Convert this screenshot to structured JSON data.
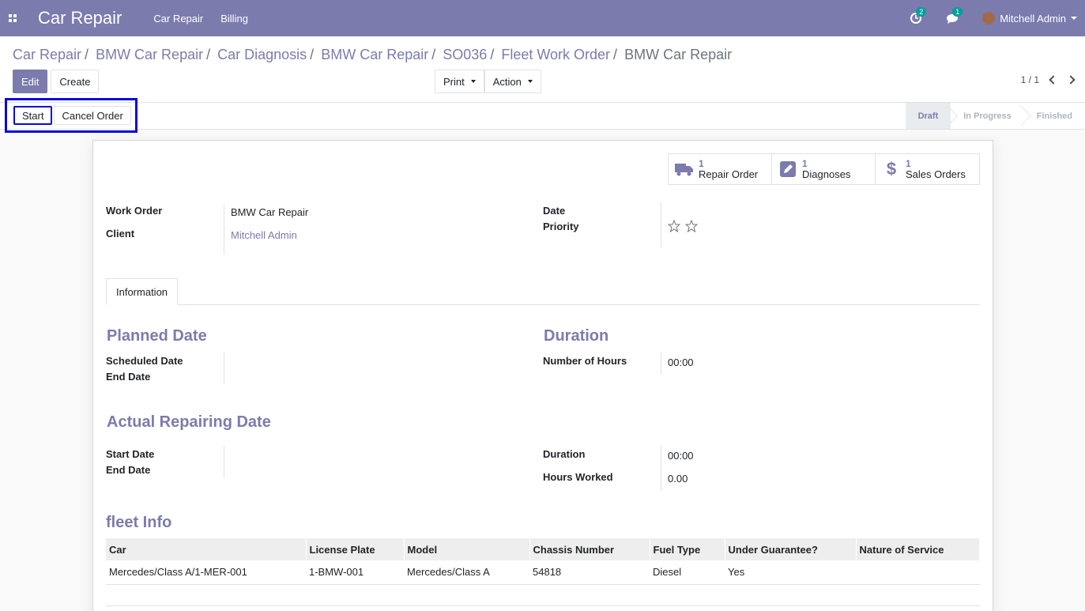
{
  "navbar": {
    "brand": "Car Repair",
    "menu": [
      "Car Repair",
      "Billing"
    ],
    "activity_count": "2",
    "message_count": "1",
    "user": "Mitchell Admin"
  },
  "breadcrumb": [
    "Car Repair",
    "BMW Car Repair",
    "Car Diagnosis",
    "BMW Car Repair",
    "SO036",
    "Fleet Work Order",
    "BMW Car Repair"
  ],
  "buttons": {
    "edit": "Edit",
    "create": "Create",
    "print": "Print",
    "action": "Action",
    "start": "Start",
    "cancel_order": "Cancel Order"
  },
  "pager": "1 / 1",
  "stages": [
    "Draft",
    "In Progress",
    "Finished"
  ],
  "current_stage": "Draft",
  "smart_buttons": [
    {
      "count": "1",
      "label": "Repair Order",
      "icon": "truck-icon"
    },
    {
      "count": "1",
      "label": "Diagnoses",
      "icon": "pencil-square-icon"
    },
    {
      "count": "1",
      "label": "Sales Orders",
      "icon": "dollar-icon"
    }
  ],
  "form": {
    "work_order_label": "Work Order",
    "work_order": "BMW Car Repair",
    "client_label": "Client",
    "client": "Mitchell Admin",
    "date_label": "Date",
    "priority_label": "Priority",
    "tab_information": "Information",
    "planned_date_title": "Planned Date",
    "scheduled_date_label": "Scheduled Date",
    "end_date_label": "End Date",
    "duration_title": "Duration",
    "number_of_hours_label": "Number of Hours",
    "number_of_hours": "00:00",
    "actual_title": "Actual Repairing Date",
    "start_date_label": "Start Date",
    "actual_end_date_label": "End Date",
    "duration_label": "Duration",
    "duration": "00:00",
    "hours_worked_label": "Hours Worked",
    "hours_worked": "0.00",
    "fleet_title": "fleet Info"
  },
  "fleet_table": {
    "columns": [
      "Car",
      "License Plate",
      "Model",
      "Chassis Number",
      "Fuel Type",
      "Under Guarantee?",
      "Nature of Service"
    ],
    "rows": [
      [
        "Mercedes/Class A/1-MER-001",
        "1-BMW-001",
        "Mercedes/Class A",
        "54818",
        "Diesel",
        "Yes",
        ""
      ]
    ]
  }
}
